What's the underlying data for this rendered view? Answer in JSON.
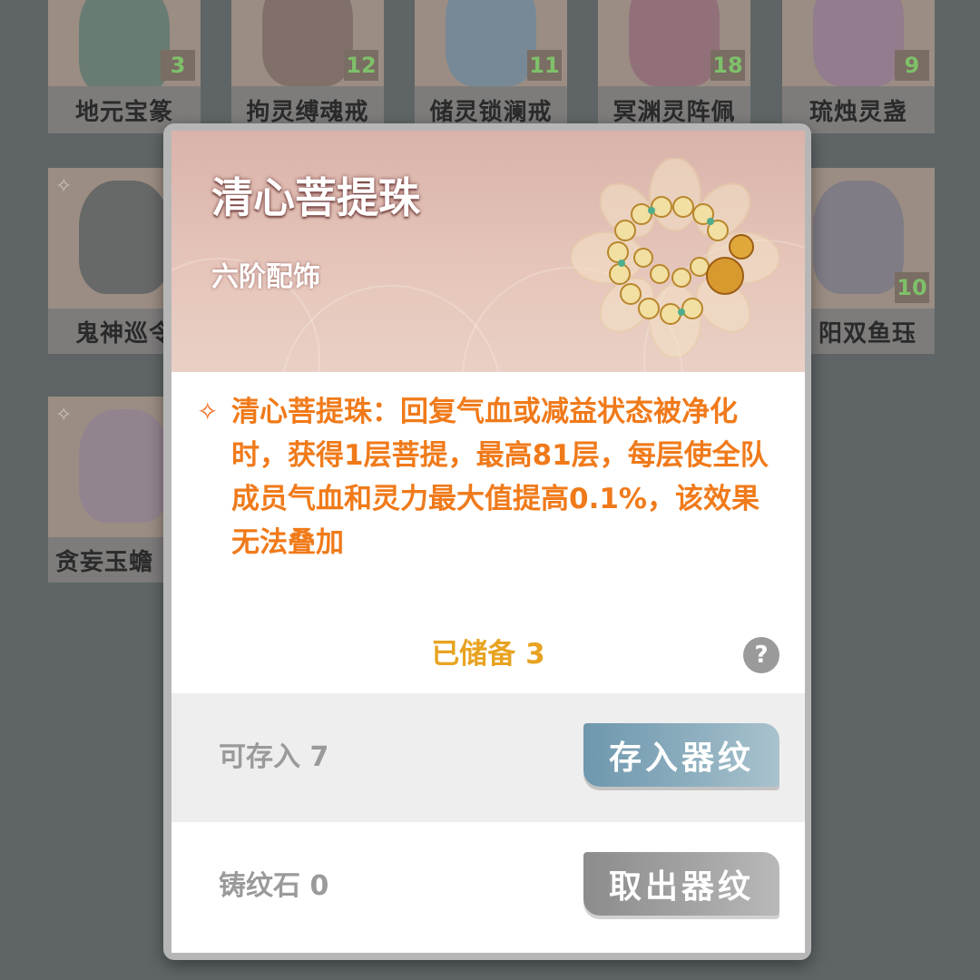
{
  "grid": {
    "top_row": [
      {
        "name": "地元宝篆",
        "count": "3"
      },
      {
        "name": "拘灵缚魂戒",
        "count": "12"
      },
      {
        "name": "储灵锁澜戒",
        "count": "11"
      },
      {
        "name": "冥渊灵阵佩",
        "count": "18"
      },
      {
        "name": "琉烛灵盏",
        "count": "9"
      }
    ],
    "middle_row": [
      {
        "name": "鬼神巡令",
        "mark": "✧"
      },
      {
        "name": "阳双鱼珏",
        "count": "10"
      }
    ],
    "bottom_row": [
      {
        "name": "贪妄玉蟾",
        "mark": "✧"
      }
    ]
  },
  "dialog": {
    "title": "清心菩提珠",
    "subtitle": "六阶配饰",
    "description": "清心菩提珠：回复气血或减益状态被净化时，获得1层菩提，最高81层，每层使全队成员气血和灵力最大值提高0.1%，该效果无法叠加",
    "stock": "已储备 3",
    "help_icon": "?",
    "store_label": "可存入 7",
    "store_button": "存入器纹",
    "take_label": "铸纹石 0",
    "take_button": "取出器纹"
  },
  "colors": {
    "accent_orange": "#f07a1a",
    "stock_gold": "#e8a321",
    "button_blue": "#7a9fb2",
    "button_gray": "#9a9a9a"
  }
}
